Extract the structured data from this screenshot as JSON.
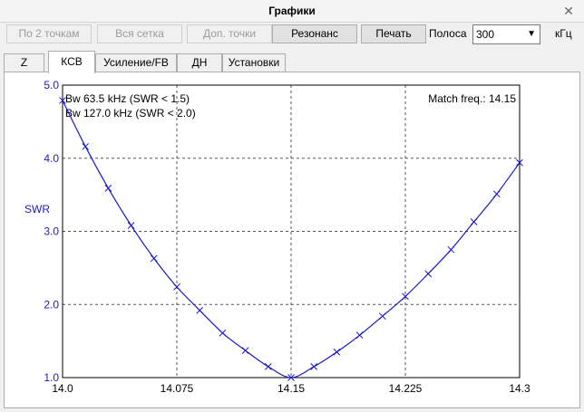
{
  "window": {
    "title": "Графики",
    "close_glyph": "✕"
  },
  "toolbar": {
    "btn_two_points": "По 2 точкам",
    "btn_all_grid": "Вся сетка",
    "btn_extra_points": "Доп. точки",
    "btn_resonance": "Резонанс",
    "btn_print": "Печать",
    "band_label": "Полоса",
    "band_value": "300",
    "band_unit": "кГц"
  },
  "tabs": [
    {
      "label": "Z",
      "active": false
    },
    {
      "label": "КСВ",
      "active": true
    },
    {
      "label": "Усиление/FB",
      "active": false
    },
    {
      "label": "ДН",
      "active": false
    },
    {
      "label": "Установки",
      "active": false
    }
  ],
  "chart_data": {
    "type": "line",
    "ylabel": "SWR",
    "xlim": [
      14.0,
      14.3
    ],
    "ylim": [
      1.0,
      5.0
    ],
    "x_ticks": [
      "14.0",
      "14.075",
      "14.15",
      "14.225",
      "14.3"
    ],
    "y_ticks": [
      "1.0",
      "2.0",
      "3.0",
      "4.0",
      "5.0"
    ],
    "grid": true,
    "line_color": "#1a1ac8",
    "annotations": {
      "bw1": "Bw 63.5 kHz (SWR < 1.5)",
      "bw2": "Bw 127.0 kHz (SWR < 2.0)",
      "match": "Match freq.: 14.15"
    },
    "x": [
      14.0,
      14.015,
      14.03,
      14.045,
      14.06,
      14.075,
      14.09,
      14.105,
      14.12,
      14.135,
      14.15,
      14.165,
      14.18,
      14.195,
      14.21,
      14.225,
      14.24,
      14.255,
      14.27,
      14.285,
      14.3
    ],
    "y": [
      4.79,
      4.16,
      3.59,
      3.08,
      2.63,
      2.24,
      1.92,
      1.61,
      1.37,
      1.15,
      1.0,
      1.15,
      1.35,
      1.58,
      1.84,
      2.11,
      2.42,
      2.75,
      3.13,
      3.51,
      3.94
    ]
  }
}
